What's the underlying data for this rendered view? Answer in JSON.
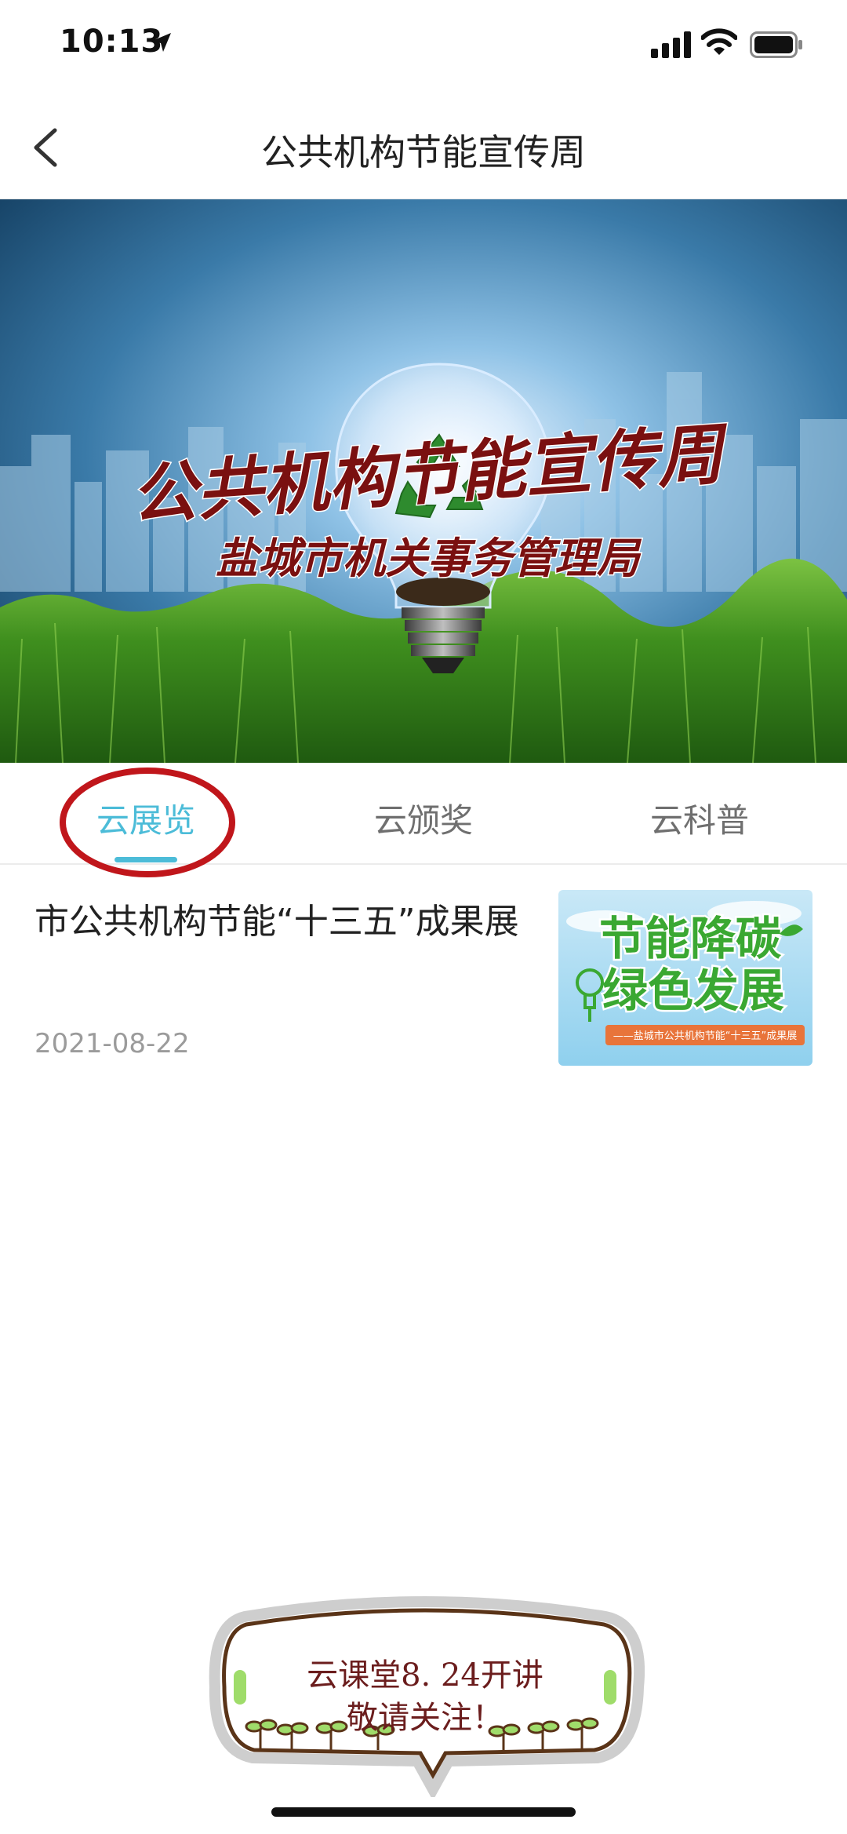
{
  "status_bar": {
    "time": "10:13",
    "icons": [
      "location-arrow-icon",
      "signal-icon",
      "wifi-icon",
      "battery-icon"
    ]
  },
  "nav": {
    "title": "公共机构节能宣传周",
    "back_icon": "chevron-left-icon"
  },
  "banner": {
    "title_art": "公共机构节能宣传周",
    "subtitle_art": "盐城市机关事务管理局",
    "colors": {
      "title": "#7a1010",
      "sky": "#1a4f73",
      "grass": "#3f8f1e"
    }
  },
  "tabs": [
    {
      "label": "云展览",
      "active": true
    },
    {
      "label": "云颁奖",
      "active": false
    },
    {
      "label": "云科普",
      "active": false
    }
  ],
  "accent_color": "#4cbcd8",
  "annotation_color": "#c0161b",
  "list": [
    {
      "title": "市公共机构节能“十三五”成果展",
      "date": "2021-08-22",
      "thumb": {
        "line1": "节能降碳",
        "line2": "绿色发展",
        "caption": "——盐城市公共机构节能“十三五”成果展"
      }
    }
  ],
  "bubble": {
    "line1": "云课堂8. 24开讲",
    "line2": "敬请关注！"
  }
}
